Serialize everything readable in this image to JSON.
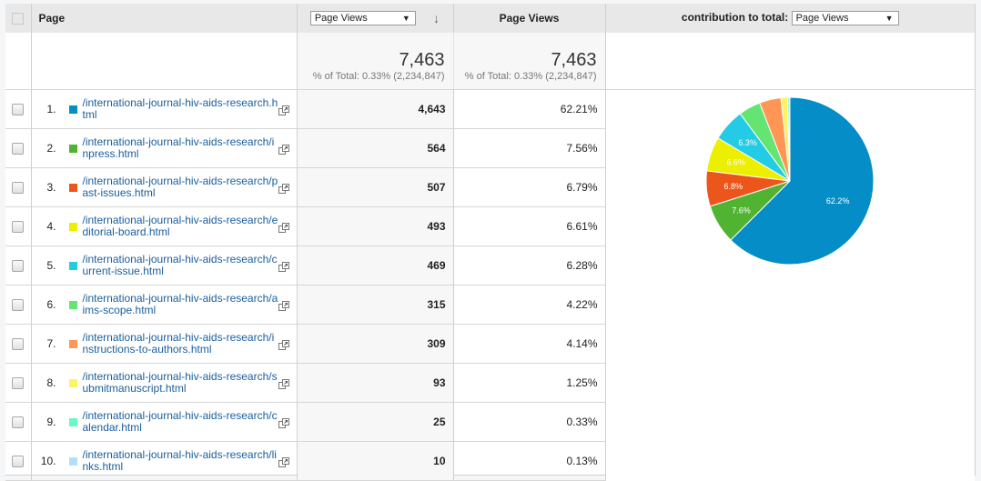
{
  "header": {
    "page_label": "Page",
    "metric_select": "Page Views",
    "metric_col_label": "Page Views",
    "contribution_label": "contribution to total:",
    "contribution_select": "Page Views"
  },
  "totals": {
    "pv_total": "7,463",
    "pv_sub": "% of Total: 0.33% (2,234,847)",
    "pct_total": "7,463",
    "pct_sub": "% of Total: 0.33% (2,234,847)"
  },
  "rows": [
    {
      "index": "1.",
      "page": "/international-journal-hiv-aids-research.html",
      "views": "4,643",
      "pct": "62.21%",
      "color": "#058dc7"
    },
    {
      "index": "2.",
      "page": "/international-journal-hiv-aids-research/inpress.html",
      "views": "564",
      "pct": "7.56%",
      "color": "#50b432"
    },
    {
      "index": "3.",
      "page": "/international-journal-hiv-aids-research/past-issues.html",
      "views": "507",
      "pct": "6.79%",
      "color": "#ed561b"
    },
    {
      "index": "4.",
      "page": "/international-journal-hiv-aids-research/editorial-board.html",
      "views": "493",
      "pct": "6.61%",
      "color": "#edef00"
    },
    {
      "index": "5.",
      "page": "/international-journal-hiv-aids-research/current-issue.html",
      "views": "469",
      "pct": "6.28%",
      "color": "#24cbe5"
    },
    {
      "index": "6.",
      "page": "/international-journal-hiv-aids-research/aims-scope.html",
      "views": "315",
      "pct": "4.22%",
      "color": "#64e572"
    },
    {
      "index": "7.",
      "page": "/international-journal-hiv-aids-research/instructions-to-authors.html",
      "views": "309",
      "pct": "4.14%",
      "color": "#ff9655"
    },
    {
      "index": "8.",
      "page": "/international-journal-hiv-aids-research/submitmanuscript.html",
      "views": "93",
      "pct": "1.25%",
      "color": "#fff263"
    },
    {
      "index": "9.",
      "page": "/international-journal-hiv-aids-research/calendar.html",
      "views": "25",
      "pct": "0.33%",
      "color": "#6af9c4"
    },
    {
      "index": "10.",
      "page": "/international-journal-hiv-aids-research/links.html",
      "views": "10",
      "pct": "0.13%",
      "color": "#b2deff"
    }
  ],
  "chart_data": {
    "type": "pie",
    "title": "",
    "categories": [
      "1",
      "2",
      "3",
      "4",
      "5",
      "6",
      "7",
      "8",
      "9",
      "10"
    ],
    "values": [
      62.21,
      7.56,
      6.79,
      6.61,
      6.28,
      4.22,
      4.14,
      1.25,
      0.33,
      0.13
    ],
    "colors": [
      "#058dc7",
      "#50b432",
      "#ed561b",
      "#edef00",
      "#24cbe5",
      "#64e572",
      "#ff9655",
      "#fff263",
      "#6af9c4",
      "#b2deff"
    ],
    "slice_labels": [
      "62.2%",
      "7.6%",
      "6.8%",
      "6.6%",
      "6.3%",
      "",
      "",
      "",
      "",
      ""
    ]
  }
}
